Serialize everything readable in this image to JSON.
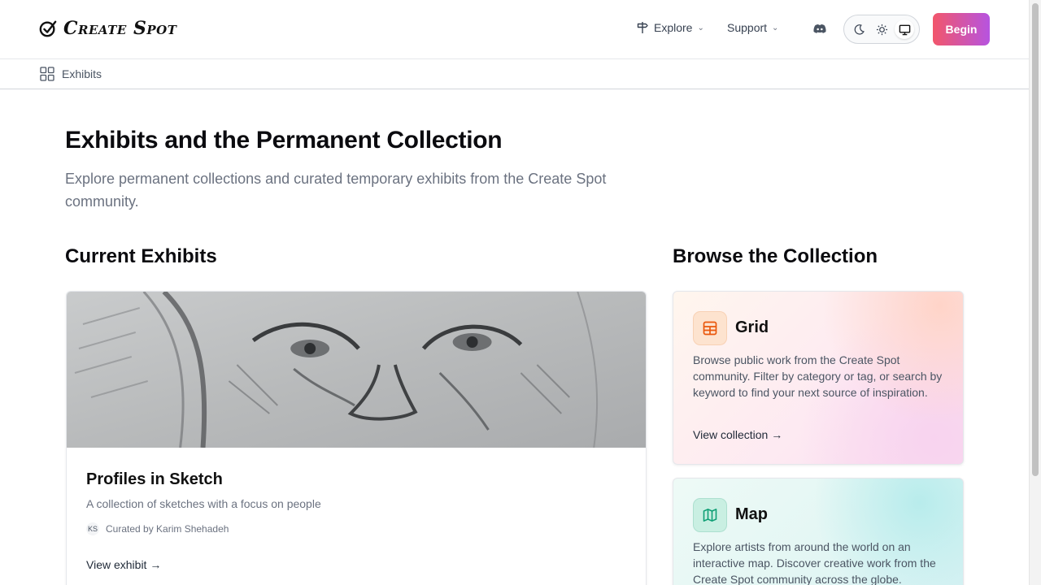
{
  "brand": {
    "name": "Create Spot"
  },
  "nav": {
    "explore_label": "Explore",
    "support_label": "Support",
    "begin_label": "Begin"
  },
  "theme": {
    "options": [
      "dark",
      "light",
      "system"
    ],
    "selected": "system"
  },
  "breadcrumb": {
    "label": "Exhibits"
  },
  "page": {
    "title": "Exhibits and the Permanent Collection",
    "description": "Explore permanent collections and curated temporary exhibits from the Create Spot community."
  },
  "current_exhibits": {
    "heading": "Current Exhibits",
    "items": [
      {
        "title": "Profiles in Sketch",
        "description": "A collection of sketches with a focus on people",
        "curator_initials": "KS",
        "curator_text": "Curated by Karim Shehadeh",
        "link_label": "View exhibit →"
      }
    ]
  },
  "browse": {
    "heading": "Browse the Collection",
    "cards": [
      {
        "title": "Grid",
        "icon": "grid-table-icon",
        "accent": "#ea580c",
        "description": "Browse public work from the Create Spot community. Filter by category or tag, or search by keyword to find your next source of inspiration.",
        "link_label": "View collection →"
      },
      {
        "title": "Map",
        "icon": "map-icon",
        "accent": "#0f9f75",
        "description": "Explore artists from around the world on an interactive map. Discover creative work from the Create Spot community across the globe."
      }
    ]
  },
  "colors": {
    "begin_gradient_start": "#f2566b",
    "begin_gradient_end": "#b654e0"
  }
}
